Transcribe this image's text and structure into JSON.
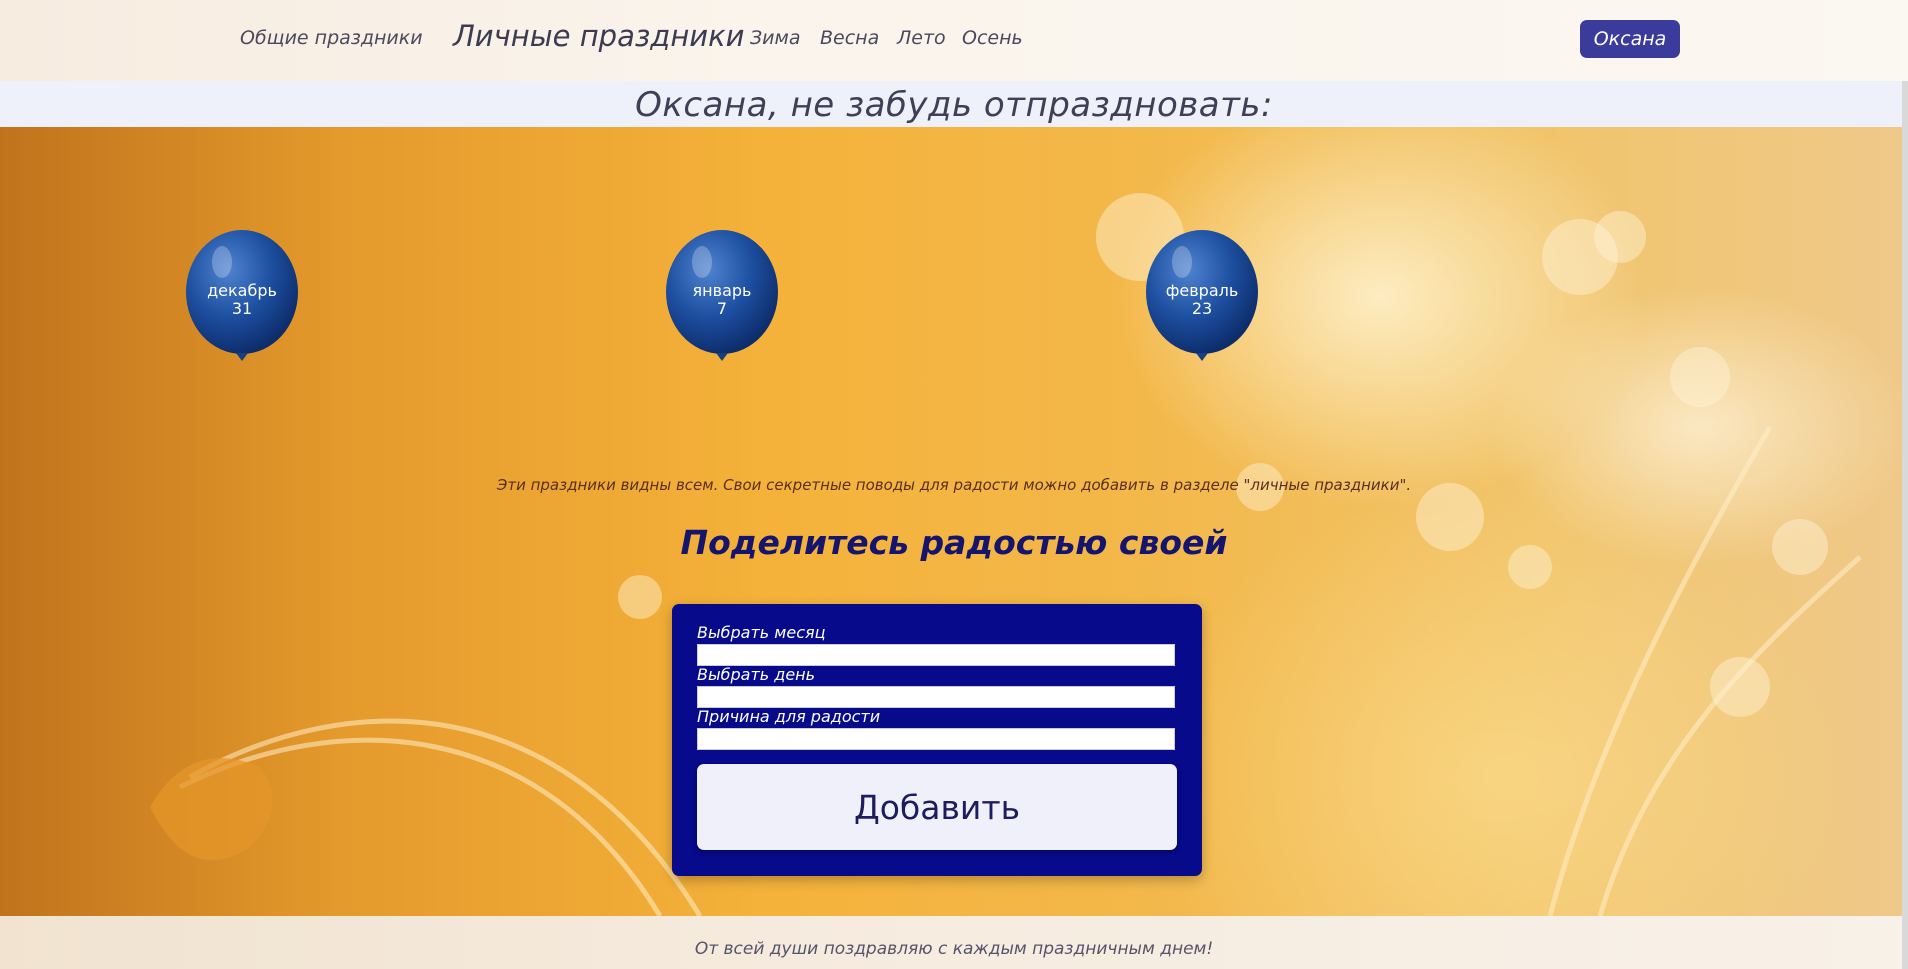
{
  "nav": {
    "links": [
      "Общие праздники",
      "Личные праздники",
      "Зима",
      "Весна",
      "Лето",
      "Осень"
    ],
    "user_button": "Оксана"
  },
  "banner": {
    "title": "Оксана, не забудь отпраздновать:"
  },
  "balloons": [
    {
      "month": "декабрь",
      "day": "31"
    },
    {
      "month": "январь",
      "day": "7"
    },
    {
      "month": "февраль",
      "day": "23"
    }
  ],
  "note": "Эти праздники видны всем. Свои секретные поводы для радости можно добавить в разделе \"личные праздники\".",
  "share_heading": "Поделитесь радостью своей",
  "form": {
    "month_label": "Выбрать месяц",
    "month_value": "",
    "day_label": "Выбрать день",
    "day_value": "",
    "reason_label": "Причина для радости",
    "reason_value": "",
    "submit_label": "Добавить"
  },
  "footer": {
    "text": "От всей души поздравляю с каждым праздничным днем!"
  },
  "colors": {
    "nav_button": "#3a3b9a",
    "form_bg": "#070a8a",
    "heading": "#15156e",
    "balloon": "#1d4fa0"
  }
}
